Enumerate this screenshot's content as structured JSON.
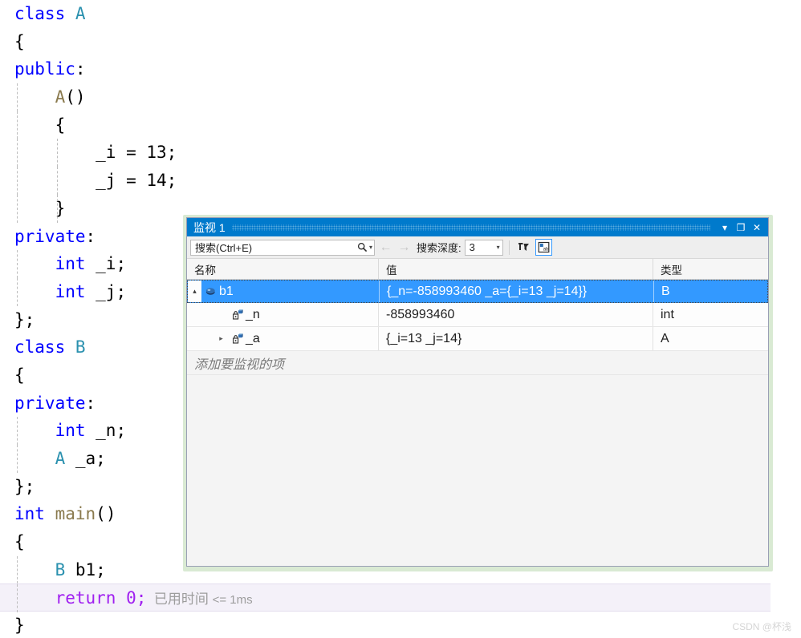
{
  "editor": {
    "language": "cpp",
    "lines": [
      {
        "indent_guides": [],
        "tokens": [
          {
            "t": "class ",
            "c": "kw"
          },
          {
            "t": "A",
            "c": "typ"
          }
        ]
      },
      {
        "indent_guides": [],
        "tokens": [
          {
            "t": "{",
            "c": "plain"
          }
        ]
      },
      {
        "indent_guides": [],
        "tokens": [
          {
            "t": "public",
            "c": "kw"
          },
          {
            "t": ":",
            "c": "plain"
          }
        ]
      },
      {
        "indent_guides": [
          1
        ],
        "tokens": [
          {
            "t": "    ",
            "c": "plain"
          },
          {
            "t": "A",
            "c": "fn"
          },
          {
            "t": "()",
            "c": "plain"
          }
        ]
      },
      {
        "indent_guides": [
          1
        ],
        "tokens": [
          {
            "t": "    {",
            "c": "plain"
          }
        ]
      },
      {
        "indent_guides": [
          1,
          2
        ],
        "tokens": [
          {
            "t": "        _i = ",
            "c": "plain"
          },
          {
            "t": "13",
            "c": "num"
          },
          {
            "t": ";",
            "c": "plain"
          }
        ]
      },
      {
        "indent_guides": [
          1,
          2
        ],
        "tokens": [
          {
            "t": "        _j = ",
            "c": "plain"
          },
          {
            "t": "14",
            "c": "num"
          },
          {
            "t": ";",
            "c": "plain"
          }
        ]
      },
      {
        "indent_guides": [
          1,
          2
        ],
        "tokens": [
          {
            "t": "    }",
            "c": "plain"
          }
        ]
      },
      {
        "indent_guides": [],
        "tokens": [
          {
            "t": "private",
            "c": "kw"
          },
          {
            "t": ":",
            "c": "plain"
          }
        ]
      },
      {
        "indent_guides": [
          1
        ],
        "tokens": [
          {
            "t": "    ",
            "c": "plain"
          },
          {
            "t": "int",
            "c": "kw"
          },
          {
            "t": " _i;",
            "c": "plain"
          }
        ]
      },
      {
        "indent_guides": [
          1
        ],
        "tokens": [
          {
            "t": "    ",
            "c": "plain"
          },
          {
            "t": "int",
            "c": "kw"
          },
          {
            "t": " _j;",
            "c": "plain"
          }
        ]
      },
      {
        "indent_guides": [],
        "tokens": [
          {
            "t": "};",
            "c": "plain"
          }
        ]
      },
      {
        "indent_guides": [],
        "tokens": [
          {
            "t": "class ",
            "c": "kw"
          },
          {
            "t": "B",
            "c": "typ"
          }
        ]
      },
      {
        "indent_guides": [],
        "tokens": [
          {
            "t": "{",
            "c": "plain"
          }
        ]
      },
      {
        "indent_guides": [],
        "tokens": [
          {
            "t": "private",
            "c": "kw"
          },
          {
            "t": ":",
            "c": "plain"
          }
        ]
      },
      {
        "indent_guides": [
          1
        ],
        "tokens": [
          {
            "t": "    ",
            "c": "plain"
          },
          {
            "t": "int",
            "c": "kw"
          },
          {
            "t": " _n;",
            "c": "plain"
          }
        ]
      },
      {
        "indent_guides": [
          1
        ],
        "tokens": [
          {
            "t": "    ",
            "c": "plain"
          },
          {
            "t": "A",
            "c": "typ"
          },
          {
            "t": " _a;",
            "c": "plain"
          }
        ]
      },
      {
        "indent_guides": [],
        "tokens": [
          {
            "t": "};",
            "c": "plain"
          }
        ]
      },
      {
        "indent_guides": [],
        "tokens": [
          {
            "t": "int",
            "c": "kw"
          },
          {
            "t": " ",
            "c": "plain"
          },
          {
            "t": "main",
            "c": "fn"
          },
          {
            "t": "()",
            "c": "plain"
          }
        ]
      },
      {
        "indent_guides": [],
        "tokens": [
          {
            "t": "{",
            "c": "plain"
          }
        ]
      },
      {
        "indent_guides": [
          1
        ],
        "tokens": [
          {
            "t": "    ",
            "c": "plain"
          },
          {
            "t": "B",
            "c": "typ"
          },
          {
            "t": " b1;",
            "c": "plain"
          }
        ]
      },
      {
        "indent_guides": [
          1
        ],
        "current": true,
        "tokens": [
          {
            "t": "    ",
            "c": "plain"
          },
          {
            "t": "return",
            "c": "retkw"
          },
          {
            "t": " ",
            "c": "plain"
          },
          {
            "t": "0",
            "c": "retkw"
          },
          {
            "t": ";",
            "c": "retkw"
          }
        ],
        "annotation": "已用时间",
        "annotation_value": "<= 1ms"
      },
      {
        "indent_guides": [],
        "tokens": [
          {
            "t": "}",
            "c": "plain"
          }
        ]
      }
    ]
  },
  "watch_window": {
    "title": "监视 1",
    "title_buttons": {
      "dropdown": "▾",
      "maximize": "❐",
      "close": "✕"
    },
    "toolbar": {
      "search_placeholder": "搜索(Ctrl+E)",
      "search_icon": "search-icon",
      "search_dropdown_caret": "▾",
      "back_arrow": "←",
      "forward_arrow": "→",
      "depth_label": "搜索深度:",
      "depth_value": "3",
      "depth_caret": "▾",
      "pin_button_name": "pin-filter-icon",
      "hex_button_name": "toggle-ab-display-icon",
      "hex_button_label": "ab"
    },
    "columns": [
      {
        "key": "name",
        "label": "名称"
      },
      {
        "key": "value",
        "label": "值"
      },
      {
        "key": "type",
        "label": "类型"
      }
    ],
    "rows": [
      {
        "level": 0,
        "expander": "▴",
        "expanded": true,
        "glyph": "object-icon",
        "name": "b1",
        "value": "{_n=-858993460 _a={_i=13 _j=14}}",
        "type": "B",
        "selected": true
      },
      {
        "level": 1,
        "expander": "",
        "expanded": false,
        "glyph": "private-field-icon",
        "name": "_n",
        "value": "-858993460",
        "type": "int",
        "selected": false
      },
      {
        "level": 1,
        "expander": "▸",
        "expanded": false,
        "glyph": "private-field-icon",
        "name": "_a",
        "value": "{_i=13 _j=14}",
        "type": "A",
        "selected": false
      }
    ],
    "add_row_placeholder": "添加要监视的项"
  },
  "watermark": "CSDN @杯浅",
  "colors": {
    "accent_blue": "#007acc",
    "selection_blue": "#3399ff",
    "keyword_blue": "#0000ff",
    "type_teal": "#2b91af",
    "function_tan": "#8a7a4e",
    "return_purple": "#a020f0",
    "shadow_green": "#d9ead3",
    "current_line_bg": "#f4f1f9"
  }
}
